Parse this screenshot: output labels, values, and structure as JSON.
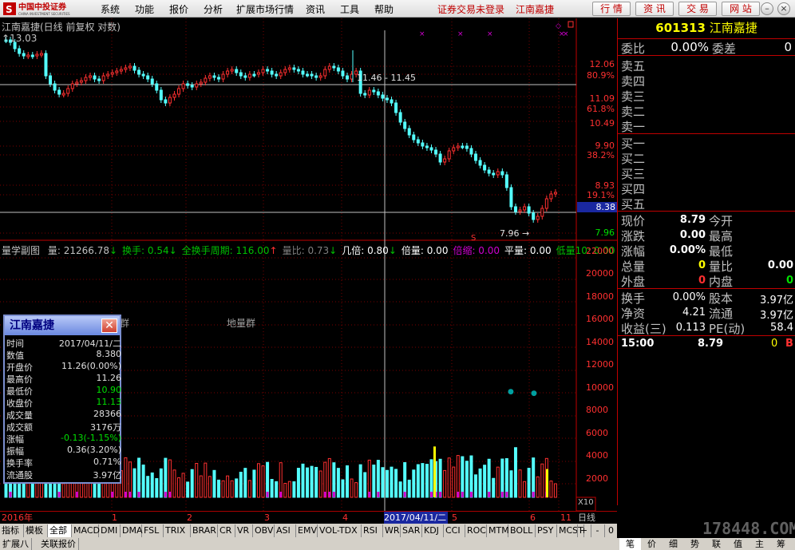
{
  "menubar": {
    "items": [
      "系统",
      "功能",
      "报价",
      "分析",
      "扩展市场行情",
      "资讯",
      "工具",
      "帮助"
    ],
    "status_msg": "证券交易未登录",
    "stock_name": "江南嘉捷",
    "right_buttons": [
      "行 情",
      "资 讯",
      "交 易",
      "网 站"
    ],
    "logo_cn": "中国中投证券",
    "logo_en": "CHINA INVESTMENT SECURITIES"
  },
  "chart_header": {
    "title": "江南嘉捷(日线 前复权 对数)",
    "top_price": "13.03"
  },
  "price_axis": {
    "labels": [
      "12.06",
      "80.9%",
      "11.09",
      "61.8%",
      "10.49",
      "9.90",
      "38.2%",
      "8.93",
      "19.1%",
      "8.38",
      "7.96"
    ]
  },
  "annotations": {
    "crosshair": "11.46 - 11.45",
    "low": "7.96",
    "vol_group": "地量群"
  },
  "volume_header": {
    "title": "量学副图",
    "items": [
      {
        "label": "量: 21266.78",
        "color": "#c0c0c0",
        "arrow": "↓",
        "arrow_color": "#00c000"
      },
      {
        "label": "换手: 0.54",
        "color": "#00c000",
        "arrow": "↓",
        "arrow_color": "#00c000"
      },
      {
        "label": "全换手周期: 116.00",
        "color": "#00c000",
        "arrow": "↑",
        "arrow_color": "#ff3030"
      },
      {
        "label": "量比: 0.73",
        "color": "#808080",
        "arrow": "↓",
        "arrow_color": "#00c000"
      },
      {
        "label": "几倍: 0.80",
        "color": "#fff",
        "arrow": "↓",
        "arrow_color": "#00c000"
      },
      {
        "label": "倍量: 0.00",
        "color": "#fff",
        "arrow": "",
        "arrow_color": ""
      },
      {
        "label": "倍缩: 0.00",
        "color": "#d000d0",
        "arrow": "",
        "arrow_color": ""
      },
      {
        "label": "平量: 0.00",
        "color": "#fff",
        "arrow": "",
        "arrow_color": ""
      },
      {
        "label": "低量10: 0.00",
        "color": "#00c000",
        "arrow": "",
        "arrow_color": ""
      }
    ]
  },
  "volume_axis": {
    "labels": [
      "22000",
      "20000",
      "18000",
      "16000",
      "14000",
      "12000",
      "10000",
      "8000",
      "6000",
      "4000",
      "2000"
    ],
    "unit": "X10"
  },
  "date_axis": {
    "labels": [
      "2016年",
      "1",
      "2",
      "3",
      "4",
      "5",
      "6",
      "11"
    ],
    "current_date": "2017/04/11/二",
    "period": "日线"
  },
  "indicator_tabs": [
    "指标",
    "模板",
    "全部",
    "MACD",
    "DMI",
    "DMA",
    "FSL",
    "TRIX",
    "BRAR",
    "CR",
    "VR",
    "OBV",
    "ASI",
    "EMV",
    "VOL-TDX",
    "RSI",
    "WR",
    "SAR",
    "KDJ",
    "CCI",
    "ROC",
    "MTM",
    "BOLL",
    "PSY",
    "MCST"
  ],
  "indicator_nav": [
    "+",
    "-",
    "0"
  ],
  "bottom_tabs": [
    "扩展八",
    "关联报价"
  ],
  "right_bottom_tabs": [
    "笔",
    "价",
    "细",
    "势",
    "联",
    "值",
    "主",
    "筹"
  ],
  "quote_panel": {
    "code": "601313",
    "name": "江南嘉捷",
    "weibi_label": "委比",
    "weibi_val": "0.00%",
    "weicha_label": "委差",
    "weicha_val": "0",
    "sell": [
      "卖五",
      "卖四",
      "卖三",
      "卖二",
      "卖一"
    ],
    "buy": [
      "买一",
      "买二",
      "买三",
      "买四",
      "买五"
    ],
    "rows": [
      {
        "l1": "现价",
        "v1": "8.79",
        "c1": "#ffffff",
        "l2": "今开",
        "v2": "",
        "c2": "#ffffff"
      },
      {
        "l1": "涨跌",
        "v1": "0.00",
        "c1": "#ffffff",
        "l2": "最高",
        "v2": "",
        "c2": "#ffffff"
      },
      {
        "l1": "涨幅",
        "v1": "0.00%",
        "c1": "#ffffff",
        "l2": "最低",
        "v2": "",
        "c2": "#ffffff"
      },
      {
        "l1": "总量",
        "v1": "0",
        "c1": "#ffff00",
        "l2": "量比",
        "v2": "0.00",
        "c2": "#ffffff"
      },
      {
        "l1": "外盘",
        "v1": "0",
        "c1": "#ff3030",
        "l2": "内盘",
        "v2": "0",
        "c2": "#00e000"
      }
    ],
    "rows2": [
      {
        "l1": "换手",
        "v1": "0.00%",
        "l2": "股本",
        "v2": "3.97亿"
      },
      {
        "l1": "净资",
        "v1": "4.21",
        "l2": "流通",
        "v2": "3.97亿"
      },
      {
        "l1": "收益(三)",
        "v1": "0.113",
        "l2": "PE(动)",
        "v2": "58.4"
      }
    ],
    "tick": {
      "time": "15:00",
      "price": "8.79",
      "vol": "0",
      "dir": "B"
    }
  },
  "popup": {
    "title": "江南嘉捷",
    "rows": [
      {
        "label": "时间",
        "value": "2017/04/11/二",
        "color": "#e0e0e0"
      },
      {
        "label": "数值",
        "value": "8.380",
        "color": "#e0e0e0"
      },
      {
        "label": "开盘价",
        "value": "11.26(0.00%)",
        "color": "#e0e0e0"
      },
      {
        "label": "最高价",
        "value": "11.26",
        "color": "#e0e0e0"
      },
      {
        "label": "最低价",
        "value": "10.90",
        "color": "#00e000"
      },
      {
        "label": "收盘价",
        "value": "11.13",
        "color": "#00e000"
      },
      {
        "label": "成交量",
        "value": "28366",
        "color": "#e0e0e0"
      },
      {
        "label": "成交额",
        "value": "3176万",
        "color": "#e0e0e0"
      },
      {
        "label": "涨幅",
        "value": "-0.13(-1.15%)",
        "color": "#00e000"
      },
      {
        "label": "振幅",
        "value": "0.36(3.20%)",
        "color": "#e0e0e0"
      },
      {
        "label": "换手率",
        "value": "0.71%",
        "color": "#e0e0e0"
      },
      {
        "label": "流通股",
        "value": "3.97亿",
        "color": "#e0e0e0"
      }
    ]
  },
  "watermark": "178448.COM",
  "colors": {
    "up": "#ff3030",
    "down": "#54ffff",
    "accent": "#c00000"
  }
}
